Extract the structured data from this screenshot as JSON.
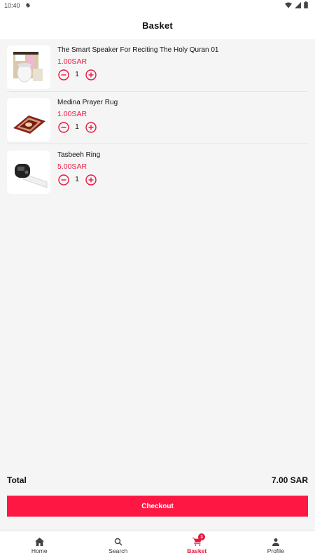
{
  "status_bar": {
    "time": "10:40",
    "icons": [
      "gear-icon",
      "wifi-icon",
      "signal-icon",
      "battery-icon"
    ]
  },
  "header": {
    "title": "Basket"
  },
  "basket": {
    "items": [
      {
        "name": "The Smart Speaker For Reciting The Holy Quran 01",
        "price": "1.00SAR",
        "quantity": "1",
        "image": "quran-speaker-product-image"
      },
      {
        "name": "Medina Prayer Rug",
        "price": "1.00SAR",
        "quantity": "1",
        "image": "prayer-rug-product-image"
      },
      {
        "name": "Tasbeeh Ring",
        "price": "5.00SAR",
        "quantity": "1",
        "image": "tasbeeh-ring-product-image"
      }
    ]
  },
  "summary": {
    "total_label": "Total",
    "total_value": "7.00 SAR"
  },
  "checkout": {
    "label": "Checkout"
  },
  "bottom_nav": {
    "items": [
      {
        "label": "Home",
        "icon": "home-icon"
      },
      {
        "label": "Search",
        "icon": "search-icon"
      },
      {
        "label": "Basket",
        "icon": "cart-icon",
        "badge": "3",
        "active": true
      },
      {
        "label": "Profile",
        "icon": "person-icon"
      }
    ]
  },
  "colors": {
    "accent": "#e8163e",
    "checkout_bg": "#ff1744",
    "background": "#f5f5f5"
  }
}
